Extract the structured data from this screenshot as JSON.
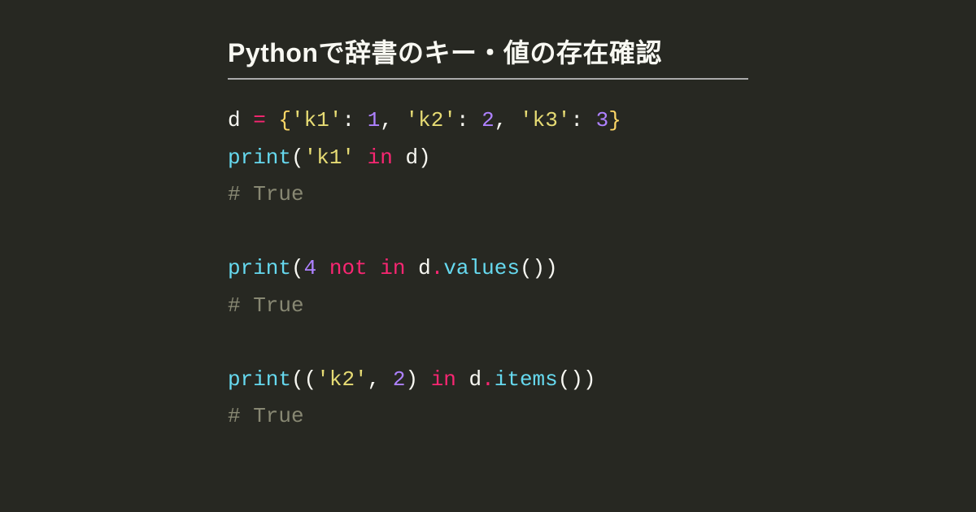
{
  "title": "Pythonで辞書のキー・値の存在確認",
  "code": {
    "lines": [
      [
        {
          "t": "d ",
          "c": "tok-var"
        },
        {
          "t": "=",
          "c": "tok-op"
        },
        {
          "t": " ",
          "c": "tok-var"
        },
        {
          "t": "{",
          "c": "tok-brace"
        },
        {
          "t": "'k1'",
          "c": "tok-str"
        },
        {
          "t": ": ",
          "c": "tok-punc"
        },
        {
          "t": "1",
          "c": "tok-num"
        },
        {
          "t": ", ",
          "c": "tok-punc"
        },
        {
          "t": "'k2'",
          "c": "tok-str"
        },
        {
          "t": ": ",
          "c": "tok-punc"
        },
        {
          "t": "2",
          "c": "tok-num"
        },
        {
          "t": ", ",
          "c": "tok-punc"
        },
        {
          "t": "'k3'",
          "c": "tok-str"
        },
        {
          "t": ": ",
          "c": "tok-punc"
        },
        {
          "t": "3",
          "c": "tok-num"
        },
        {
          "t": "}",
          "c": "tok-brace"
        }
      ],
      [
        {
          "t": "print",
          "c": "tok-func"
        },
        {
          "t": "(",
          "c": "tok-punc"
        },
        {
          "t": "'k1'",
          "c": "tok-str"
        },
        {
          "t": " ",
          "c": "tok-var"
        },
        {
          "t": "in",
          "c": "tok-kw"
        },
        {
          "t": " d)",
          "c": "tok-punc"
        }
      ],
      [
        {
          "t": "# True",
          "c": "tok-comm"
        }
      ],
      [
        {
          "t": "",
          "c": ""
        }
      ],
      [
        {
          "t": "print",
          "c": "tok-func"
        },
        {
          "t": "(",
          "c": "tok-punc"
        },
        {
          "t": "4",
          "c": "tok-num"
        },
        {
          "t": " ",
          "c": "tok-var"
        },
        {
          "t": "not",
          "c": "tok-kw"
        },
        {
          "t": " ",
          "c": "tok-var"
        },
        {
          "t": "in",
          "c": "tok-kw"
        },
        {
          "t": " d",
          "c": "tok-punc"
        },
        {
          "t": ".",
          "c": "tok-op"
        },
        {
          "t": "values",
          "c": "tok-func"
        },
        {
          "t": "())",
          "c": "tok-punc"
        }
      ],
      [
        {
          "t": "# True",
          "c": "tok-comm"
        }
      ],
      [
        {
          "t": "",
          "c": ""
        }
      ],
      [
        {
          "t": "print",
          "c": "tok-func"
        },
        {
          "t": "((",
          "c": "tok-punc"
        },
        {
          "t": "'k2'",
          "c": "tok-str"
        },
        {
          "t": ", ",
          "c": "tok-punc"
        },
        {
          "t": "2",
          "c": "tok-num"
        },
        {
          "t": ") ",
          "c": "tok-punc"
        },
        {
          "t": "in",
          "c": "tok-kw"
        },
        {
          "t": " d",
          "c": "tok-punc"
        },
        {
          "t": ".",
          "c": "tok-op"
        },
        {
          "t": "items",
          "c": "tok-func"
        },
        {
          "t": "())",
          "c": "tok-punc"
        }
      ],
      [
        {
          "t": "# True",
          "c": "tok-comm"
        }
      ]
    ]
  }
}
